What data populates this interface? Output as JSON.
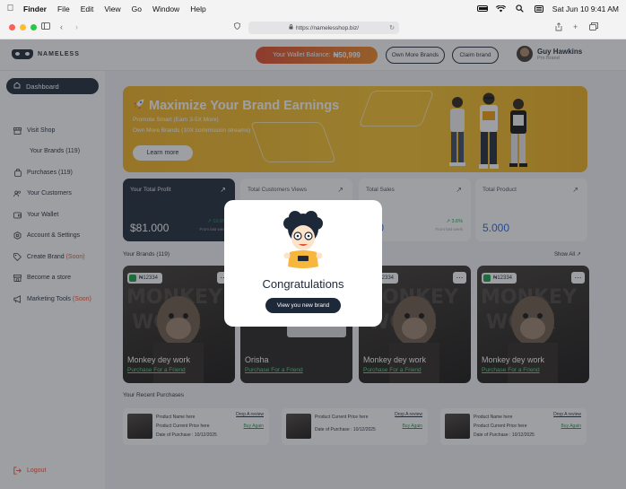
{
  "menubar": {
    "app": "Finder",
    "items": [
      "File",
      "Edit",
      "View",
      "Go",
      "Window",
      "Help"
    ],
    "datetime": "Sat Jun 10  9:41 AM"
  },
  "browser": {
    "url": "https://namelesshop.biz/"
  },
  "header": {
    "logo_text": "NAMELESS",
    "wallet_label": "Your Wallet Balance:",
    "wallet_value": "₦50,999",
    "own_more_label": "Own More Brands",
    "claim_label": "Claim brand",
    "user_name": "Guy Hawkins",
    "user_role": "Pro Brand"
  },
  "sidebar": {
    "dashboard": "Dashboard",
    "visit_shop": "Visit Shop",
    "your_brands": "Your Brands (119)",
    "purchases": "Purchases (119)",
    "customers": "Your Customers",
    "wallet": "Your Wallet",
    "account": "Account & Settings",
    "create_brand": "Create Brand",
    "create_brand_soon": "(Soon)",
    "become_store": "Become a store",
    "marketing": "Marketing Tools",
    "marketing_soon": "(Soon)",
    "logout": "Logout"
  },
  "banner": {
    "title": "Maximize Your Brand Earnings",
    "line1": "Promote Smart (Earn 3-5X More)",
    "line2": "Own More Brands (10X commission streams)",
    "button": "Learn more"
  },
  "stats": [
    {
      "label": "Your Total Profit",
      "value": "$81.000",
      "change": "↗ 10.6%",
      "since": "From last week"
    },
    {
      "label": "Total Customers Views",
      "value": "",
      "change": "",
      "since": ""
    },
    {
      "label": "Total Sales",
      "value": "000",
      "change": "↗ 3.6%",
      "since": "From last week"
    },
    {
      "label": "Total Product",
      "value": "5.000",
      "change": "",
      "since": ""
    }
  ],
  "brands_section": {
    "title": "Your Brands (119)",
    "show_all": "Show All"
  },
  "brand_cards": [
    {
      "badge": "₦12334",
      "title": "Monkey dey work",
      "link": "Purchase For a Friend"
    },
    {
      "badge": "",
      "title": "Orisha",
      "link": "Purchase For a Friend"
    },
    {
      "badge": "₦12334",
      "title": "Monkey dey work",
      "link": "Purchase For a Friend"
    },
    {
      "badge": "₦12334",
      "title": "Monkey dey work",
      "link": "Purchase For a Friend"
    }
  ],
  "purchases_section": {
    "title": "Your Recent Purchases"
  },
  "purchases": [
    {
      "name": "Product Name here",
      "price": "Product Current Price here",
      "date": "Date of Purchase : 10/12/2025",
      "review": "Drop A review",
      "buy": "Buy Again"
    },
    {
      "name": "",
      "price": "Product Current Price here",
      "date": "Date of Purchase : 10/12/2025",
      "review": "Drop A review",
      "buy": "Buy Again"
    },
    {
      "name": "Product Name here",
      "price": "Product Current Price here",
      "date": "Date of Purchase : 10/12/2025",
      "review": "Drop A review",
      "buy": "Buy Again"
    }
  ],
  "modal": {
    "title": "Congratulations",
    "button": "View you new brand"
  },
  "colors": {
    "navy": "#1d2939",
    "banner_yellow": "#f7c42c",
    "wallet_orange": "#e04a2b",
    "soon_red": "#e5533d",
    "profit_green": "#16a34a",
    "value_blue": "#2563eb"
  }
}
